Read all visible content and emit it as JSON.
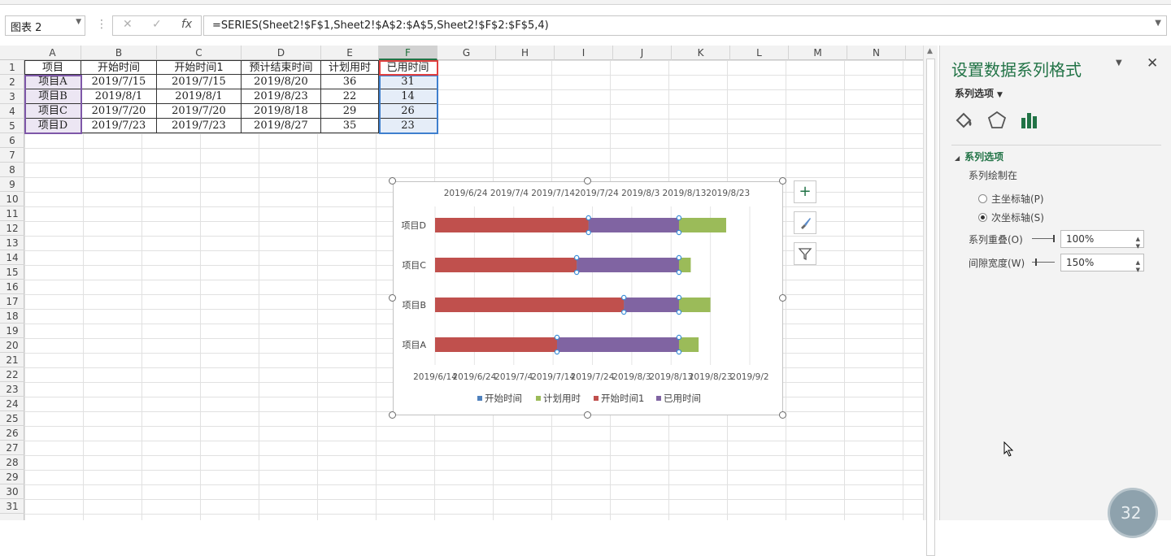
{
  "formula_bar": {
    "name_box": "图表 2",
    "fx_label": "fx",
    "cancel_glyph": "✕",
    "enter_glyph": "✓",
    "formula": "=SERIES(Sheet2!$F$1,Sheet2!$A$2:$A$5,Sheet2!$F$2:$F$5,4)"
  },
  "grid": {
    "columns": [
      "A",
      "B",
      "C",
      "D",
      "E",
      "F",
      "G",
      "H",
      "I",
      "J",
      "K",
      "L",
      "M",
      "N"
    ],
    "rows": [
      "1",
      "2",
      "3",
      "4",
      "5",
      "6",
      "7",
      "8",
      "9",
      "10",
      "11",
      "12",
      "13",
      "14",
      "15",
      "16",
      "17",
      "18",
      "19",
      "20",
      "21",
      "22",
      "23",
      "24",
      "25",
      "26",
      "27",
      "28",
      "29",
      "30",
      "31"
    ],
    "table_header": [
      "项目",
      "开始时间",
      "开始时间1",
      "预计结束时间",
      "计划用时",
      "已用时间"
    ],
    "table_rows": [
      [
        "项目A",
        "2019/7/15",
        "2019/7/15",
        "2019/8/20",
        "36",
        "31"
      ],
      [
        "项目B",
        "2019/8/1",
        "2019/8/1",
        "2019/8/23",
        "22",
        "14"
      ],
      [
        "项目C",
        "2019/7/20",
        "2019/7/20",
        "2019/8/18",
        "29",
        "26"
      ],
      [
        "项目D",
        "2019/7/23",
        "2019/7/23",
        "2019/8/27",
        "35",
        "23"
      ]
    ]
  },
  "chart_data": {
    "type": "bar",
    "orientation": "horizontal",
    "stacked": true,
    "categories": [
      "项目A",
      "项目B",
      "项目C",
      "项目D"
    ],
    "series": [
      {
        "name": "开始时间",
        "color": "#4f81bd",
        "values": [
          0,
          0,
          0,
          0
        ]
      },
      {
        "name": "计划用时",
        "color": "#9bbb59",
        "values": [
          36,
          22,
          29,
          35
        ]
      },
      {
        "name": "开始时间1",
        "color": "#c0504d",
        "values": [
          "2019/7/15",
          "2019/8/1",
          "2019/7/20",
          "2019/7/23"
        ]
      },
      {
        "name": "已用时间",
        "color": "#8064a2",
        "values": [
          31,
          14,
          26,
          23
        ]
      }
    ],
    "top_axis_ticks": [
      "2019/6/24",
      "2019/7/4",
      "2019/7/14",
      "2019/7/24",
      "2019/8/3",
      "2019/8/13",
      "2019/8/23"
    ],
    "bottom_axis_ticks": [
      "2019/6/14",
      "2019/6/24",
      "2019/7/4",
      "2019/7/14",
      "2019/7/24",
      "2019/8/3",
      "2019/8/13",
      "2019/8/23",
      "2019/9/2"
    ],
    "legend_position": "bottom",
    "grid": true
  },
  "chart_buttons": {
    "add": "+",
    "style": "brush-icon",
    "filter": "filter-icon"
  },
  "pane": {
    "title": "设置数据系列格式",
    "options_label": "系列选项",
    "section_label": "系列选项",
    "plot_on_label": "系列绘制在",
    "primary_axis": "主坐标轴(P)",
    "secondary_axis": "次坐标轴(S)",
    "overlap_label": "系列重叠(O)",
    "overlap_value": "100%",
    "gap_label": "间隙宽度(W)",
    "gap_value": "150%",
    "badge": "32"
  }
}
